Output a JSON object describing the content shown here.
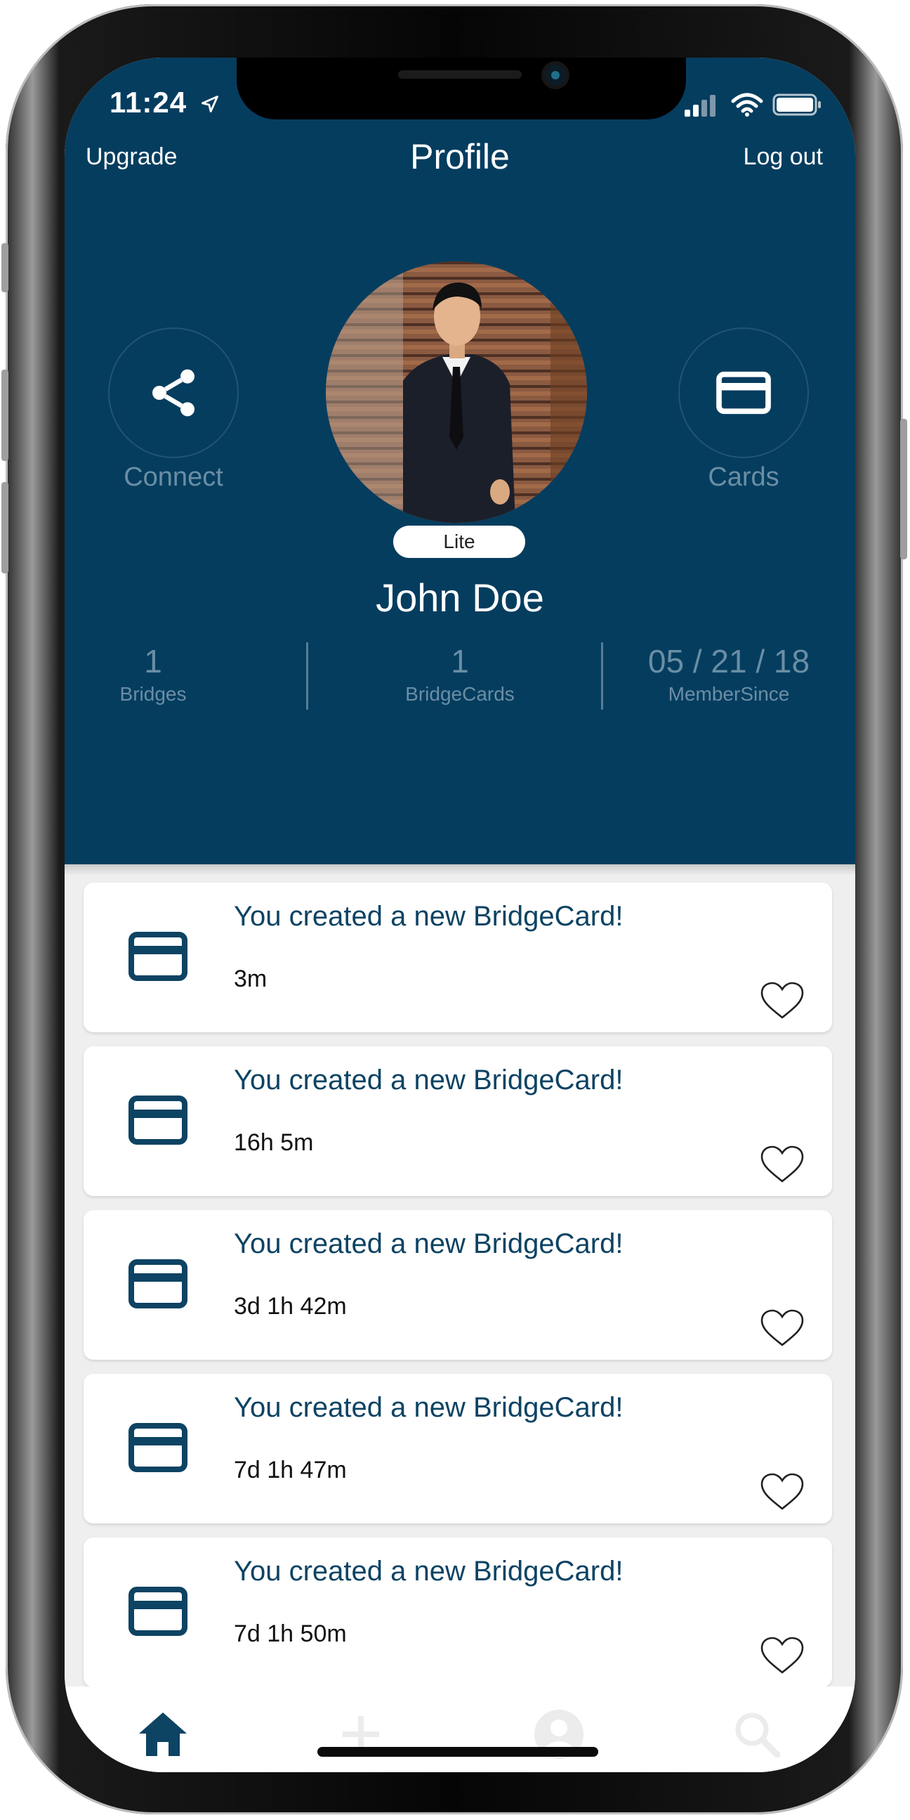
{
  "status_bar": {
    "time": "11:24"
  },
  "header": {
    "upgrade_label": "Upgrade",
    "title": "Profile",
    "logout_label": "Log out"
  },
  "profile": {
    "connect_label": "Connect",
    "cards_label": "Cards",
    "plan_badge": "Lite",
    "name": "John Doe",
    "stats": [
      {
        "value": "1",
        "label": "Bridges"
      },
      {
        "value": "1",
        "label": "BridgeCards"
      },
      {
        "value": "05 / 21 / 18",
        "label": "MemberSince"
      }
    ]
  },
  "feed": {
    "items": [
      {
        "title": "You created a new BridgeCard!",
        "time": "3m"
      },
      {
        "title": "You created a new BridgeCard!",
        "time": "16h 5m"
      },
      {
        "title": "You created a new BridgeCard!",
        "time": "3d 1h 42m"
      },
      {
        "title": "You created a new BridgeCard!",
        "time": "7d 1h 47m"
      },
      {
        "title": "You created a new BridgeCard!",
        "time": "7d 1h 50m"
      }
    ]
  },
  "tabs": [
    "home-icon",
    "add-icon",
    "profile-icon",
    "search-icon"
  ],
  "colors": {
    "header_bg": "#053d5f",
    "accent": "#0d4363",
    "muted": "#6a8ea4",
    "inactive_tab": "#ececec"
  }
}
